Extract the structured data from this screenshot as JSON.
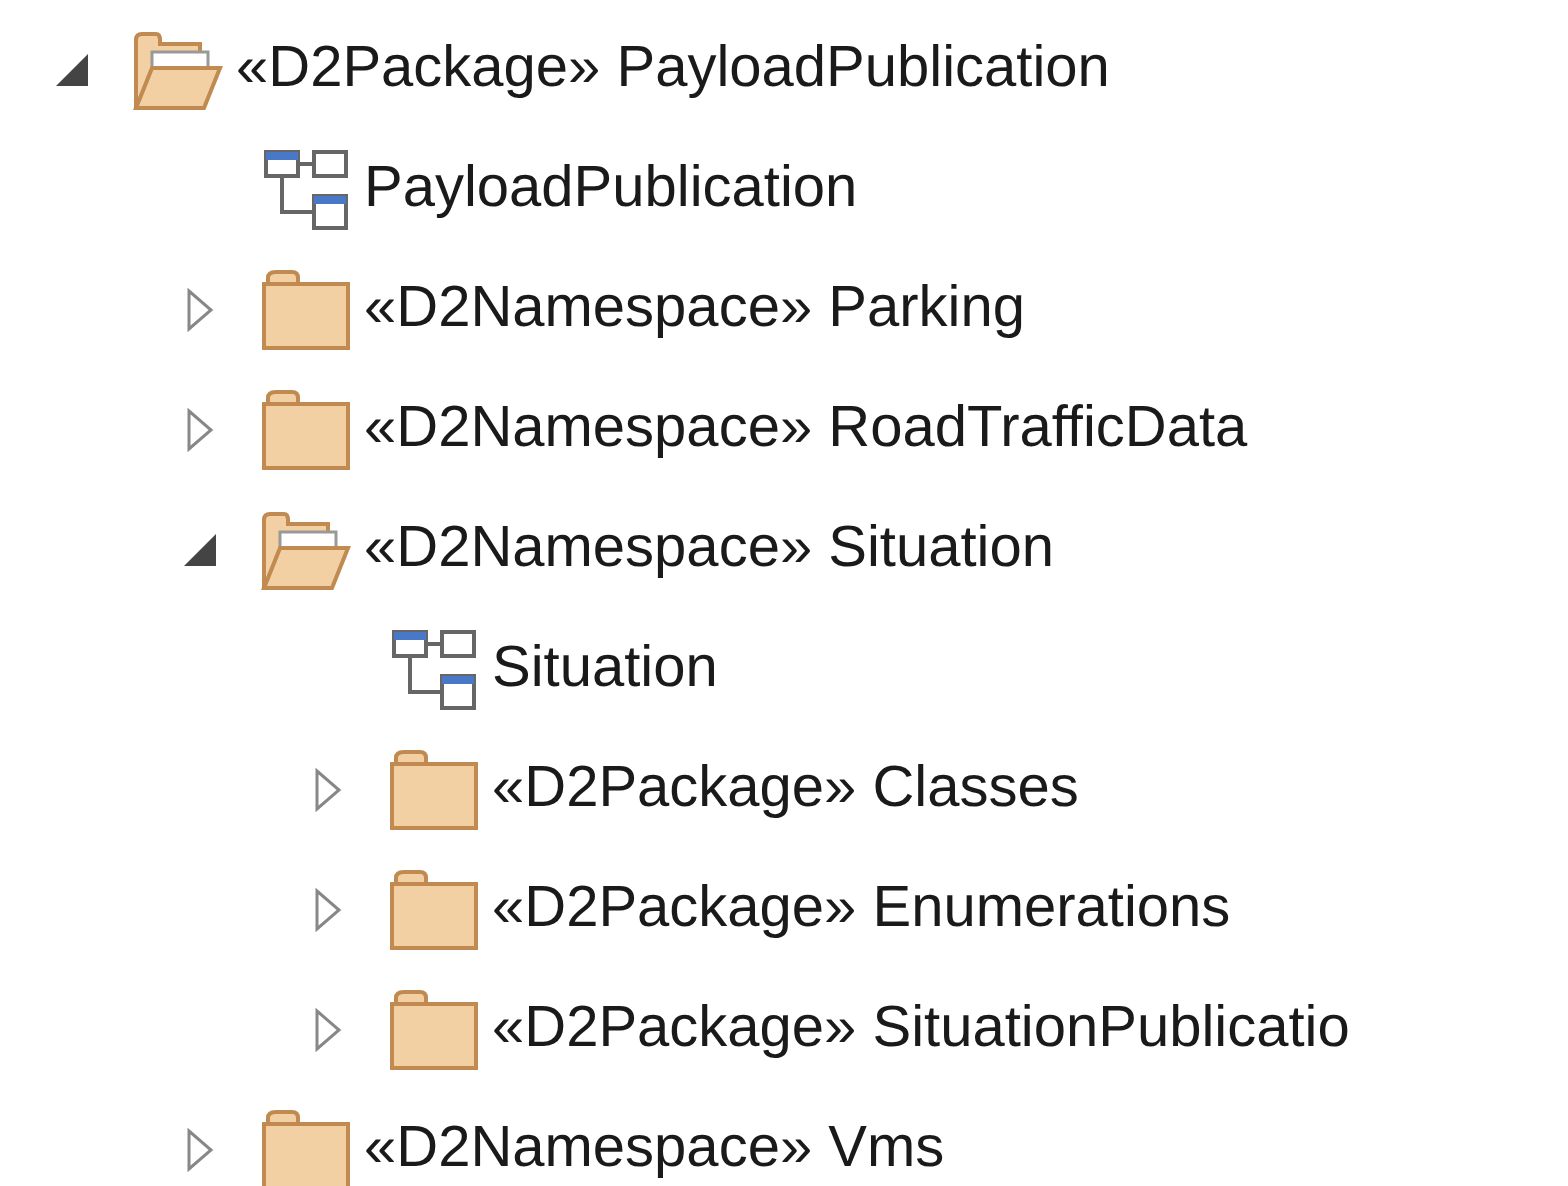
{
  "tree": [
    {
      "kind": "package",
      "label": "«D2Package» PayloadPublication",
      "expanded": true,
      "children": [
        {
          "kind": "diagram",
          "label": "PayloadPublication"
        },
        {
          "kind": "package",
          "label": "«D2Namespace» Parking",
          "expanded": false
        },
        {
          "kind": "package",
          "label": "«D2Namespace» RoadTrafficData",
          "expanded": false
        },
        {
          "kind": "package",
          "label": "«D2Namespace» Situation",
          "expanded": true,
          "children": [
            {
              "kind": "diagram",
              "label": "Situation"
            },
            {
              "kind": "package",
              "label": "«D2Package» Classes",
              "expanded": false
            },
            {
              "kind": "package",
              "label": "«D2Package» Enumerations",
              "expanded": false
            },
            {
              "kind": "package",
              "label": "«D2Package» SituationPublicatio",
              "expanded": false
            }
          ]
        },
        {
          "kind": "package",
          "label": "«D2Namespace» Vms",
          "expanded": false
        }
      ]
    }
  ]
}
